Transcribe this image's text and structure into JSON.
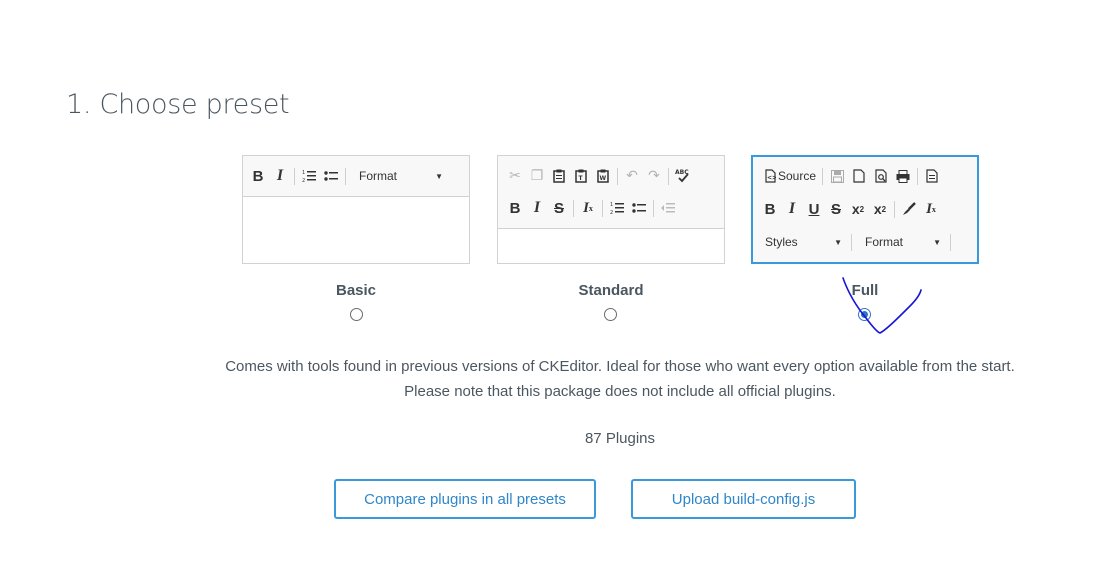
{
  "heading": "1. Choose preset",
  "presets": {
    "basic": {
      "label": "Basic",
      "format_combo": "Format"
    },
    "standard": {
      "label": "Standard"
    },
    "full": {
      "label": "Full",
      "source_label": "Source",
      "styles_combo": "Styles",
      "format_combo": "Format"
    }
  },
  "selected_preset": "Full",
  "description": {
    "line1": "Comes with tools found in previous versions of CKEditor. Ideal for those who want every option available from the start.",
    "line2": "Please note that this package does not include all official plugins."
  },
  "plugin_count": "87 Plugins",
  "buttons": {
    "compare": "Compare plugins in all presets",
    "upload": "Upload build-config.js"
  },
  "colors": {
    "accent": "#3a9ad9",
    "annotation_ink": "#1515d6",
    "text": "#4b5760"
  }
}
